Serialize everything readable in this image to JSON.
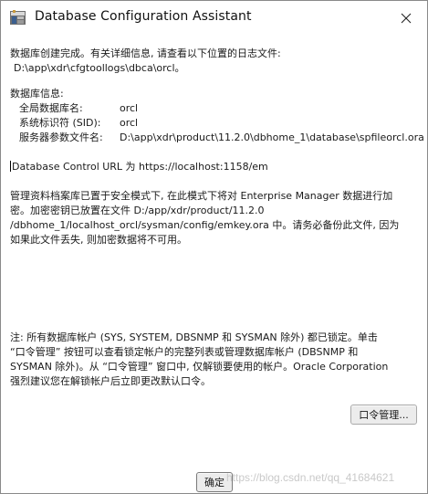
{
  "window": {
    "title": "Database Configuration Assistant",
    "app_icon": "dbca-app-icon",
    "close_icon": "close-icon"
  },
  "messages": {
    "created_line1": "数据库创建完成。有关详细信息, 请查看以下位置的日志文件:",
    "created_line2": "D:\\app\\xdr\\cfgtoollogs\\dbca\\orcl。",
    "db_info_heading": "数据库信息:",
    "db_info": [
      {
        "key": "全局数据库名:",
        "value": "orcl"
      },
      {
        "key": "系统标识符 (SID):",
        "value": "orcl"
      },
      {
        "key": "服务器参数文件名:",
        "value": "D:\\app\\xdr\\product\\11.2.0\\dbhome_1\\database\\spfileorcl.ora"
      }
    ],
    "control_url": "Database Control URL 为 https://localhost:1158/em",
    "repo_line1": "管理资料档案库已置于安全模式下, 在此模式下将对 Enterprise Manager 数据进行加",
    "repo_line2": "密。加密密钥已放置在文件 D:/app/xdr/product/11.2.0",
    "repo_line3": "/dbhome_1/localhost_orcl/sysman/config/emkey.ora 中。请务必备份此文件, 因为",
    "repo_line4": "如果此文件丢失, 则加密数据将不可用。",
    "note_line1": "注: 所有数据库帐户 (SYS, SYSTEM, DBSNMP 和 SYSMAN 除外) 都已锁定。单击",
    "note_line2": "“口令管理” 按钮可以查看锁定帐户的完整列表或管理数据库帐户 (DBSNMP 和",
    "note_line3": "SYSMAN 除外)。从 “口令管理” 窗口中, 仅解锁要使用的帐户。Oracle Corporation",
    "note_line4": "强烈建议您在解锁帐户后立即更改默认口令。"
  },
  "buttons": {
    "password_management": "口令管理...",
    "ok": "确定"
  },
  "watermark": "https://blog.csdn.net/qq_41684621"
}
